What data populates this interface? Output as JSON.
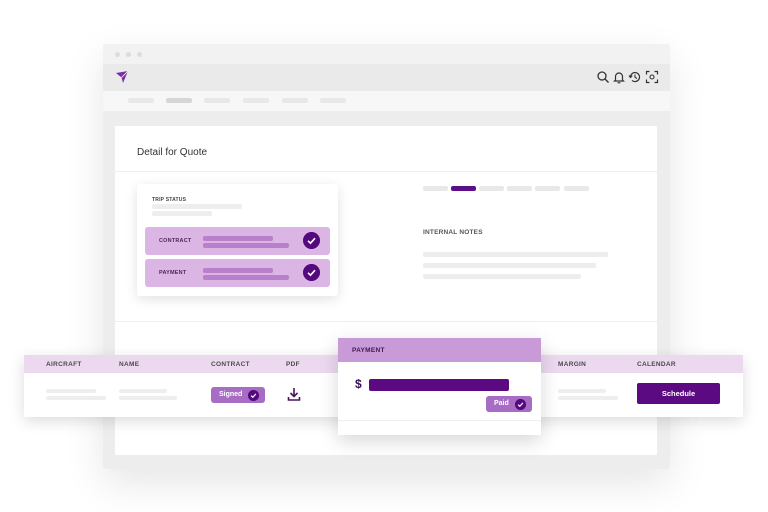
{
  "panel": {
    "title": "Detail for Quote"
  },
  "trip_status": {
    "label": "TRIP STATUS",
    "rows": [
      {
        "label": "CONTRACT",
        "checked": true
      },
      {
        "label": "PAYMENT",
        "checked": true
      }
    ]
  },
  "notes": {
    "title": "INTERNAL NOTES"
  },
  "table": {
    "headers": {
      "aircraft": "AIRCRAFT",
      "name": "NAME",
      "contract": "CONTRACT",
      "pdf": "PDF",
      "margin": "MARGIN",
      "calendar": "CALENDAR"
    },
    "row": {
      "contract_status": "Signed",
      "schedule_label": "Schedule"
    }
  },
  "payment_popup": {
    "title": "PAYMENT",
    "currency": "$",
    "status": "Paid"
  },
  "icons": [
    "paper-plane-logo-icon",
    "search-icon",
    "bell-icon",
    "history-icon",
    "scan-icon",
    "check-icon",
    "download-icon"
  ],
  "colors": {
    "brand": "#5b0a82",
    "accent_light": "#dbb6e4",
    "badge": "#a76cc4",
    "header_tint": "#ecd9f0"
  }
}
